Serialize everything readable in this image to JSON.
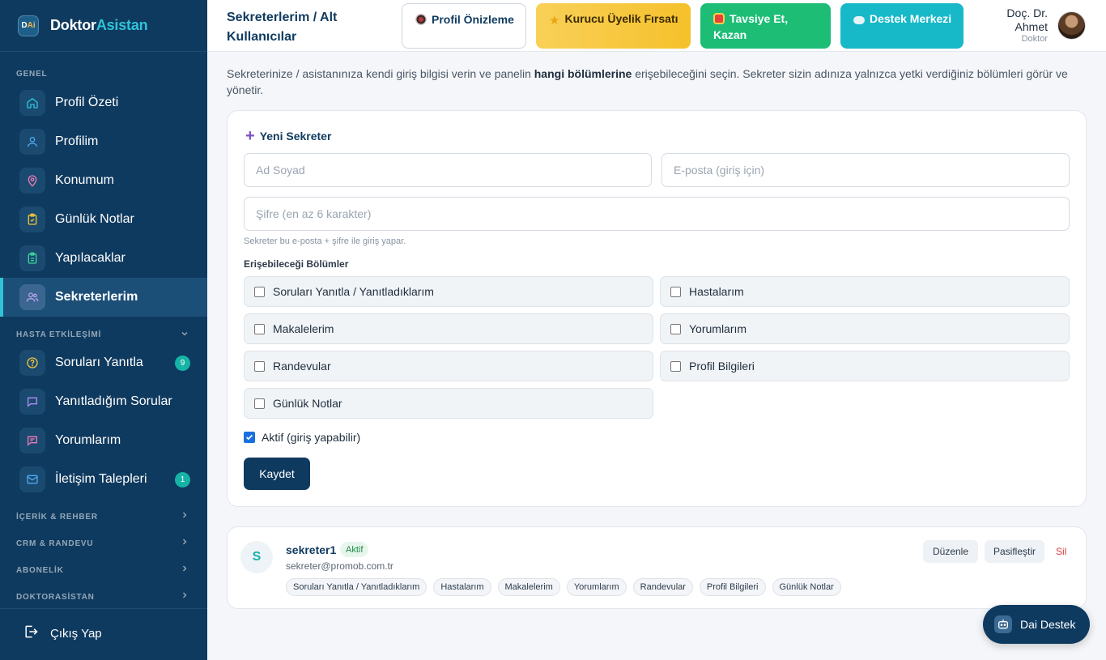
{
  "brand": {
    "logo_text_d": "D",
    "logo_text_ai": "Ai",
    "name_part1": "Doktor",
    "name_part2": "Asistan"
  },
  "sidebar": {
    "section_general": "GENEL",
    "items_general": [
      {
        "label": "Profil Özeti",
        "icon": "home-icon"
      },
      {
        "label": "Profilim",
        "icon": "user-icon"
      },
      {
        "label": "Konumum",
        "icon": "location-pin-icon"
      },
      {
        "label": "Günlük Notlar",
        "icon": "clipboard-check-icon"
      },
      {
        "label": "Yapılacaklar",
        "icon": "clipboard-list-icon"
      },
      {
        "label": "Sekreterlerim",
        "icon": "users-icon",
        "active": true
      }
    ],
    "section_patient": "HASTA ETKİLEŞİMİ",
    "items_patient": [
      {
        "label": "Soruları Yanıtla",
        "icon": "question-circle-icon",
        "badge": "9"
      },
      {
        "label": "Yanıtladığım Sorular",
        "icon": "chat-bubble-icon"
      },
      {
        "label": "Yorumlarım",
        "icon": "comment-icon"
      },
      {
        "label": "İletişim Talepleri",
        "icon": "mail-icon",
        "badge": "1"
      }
    ],
    "groups": [
      "İÇERİK & REHBER",
      "CRM & RANDEVU",
      "ABONELİK",
      "DOKTORASİSTAN"
    ],
    "logout": "Çıkış Yap"
  },
  "header": {
    "title": "Sekreterlerim / Alt Kullanıcılar",
    "buttons": {
      "preview": "Profil Önizleme",
      "founder": "Kurucu Üyelik Fırsatı",
      "refer": "Tavsiye Et, Kazan",
      "support": "Destek Merkezi"
    },
    "user_name": "Doç. Dr. Ahmet",
    "user_role": "Doktor"
  },
  "intro": {
    "part1": "Sekreterinize / asistanınıza kendi giriş bilgisi verin ve panelin ",
    "bold": "hangi bölümlerine",
    "part2": " erişebileceğini seçin. Sekreter sizin adınıza yalnızca yetki verdiğiniz bölümleri görür ve yönetir."
  },
  "form": {
    "title": "Yeni Sekreter",
    "name_placeholder": "Ad Soyad",
    "email_placeholder": "E-posta (giriş için)",
    "password_placeholder": "Şifre (en az 6 karakter)",
    "hint": "Sekreter bu e-posta + şifre ile giriş yapar.",
    "permissions_label": "Erişebileceği Bölümler",
    "permissions": [
      "Soruları Yanıtla / Yanıtladıklarım",
      "Hastalarım",
      "Makalelerim",
      "Yorumlarım",
      "Randevular",
      "Profil Bilgileri",
      "Günlük Notlar"
    ],
    "active_label": "Aktif (giriş yapabilir)",
    "active_checked": true,
    "save": "Kaydet"
  },
  "secretaries": [
    {
      "initial": "S",
      "name": "sekreter1",
      "status": "Aktif",
      "email": "sekreter@promob.com.tr",
      "tags": [
        "Soruları Yanıtla / Yanıtladıklarım",
        "Hastalarım",
        "Makalelerim",
        "Yorumlarım",
        "Randevular",
        "Profil Bilgileri",
        "Günlük Notlar"
      ],
      "actions": {
        "edit": "Düzenle",
        "deactivate": "Pasifleştir",
        "delete": "Sil"
      }
    }
  ],
  "dai_support": "Dai Destek",
  "colors": {
    "sidebar": "#0f3a5f",
    "accent": "#2fc4d8",
    "badge": "#16b3a6",
    "founder": "#f7c53a",
    "refer": "#1dbd76",
    "support": "#17b9c9",
    "danger": "#d93a3a"
  }
}
